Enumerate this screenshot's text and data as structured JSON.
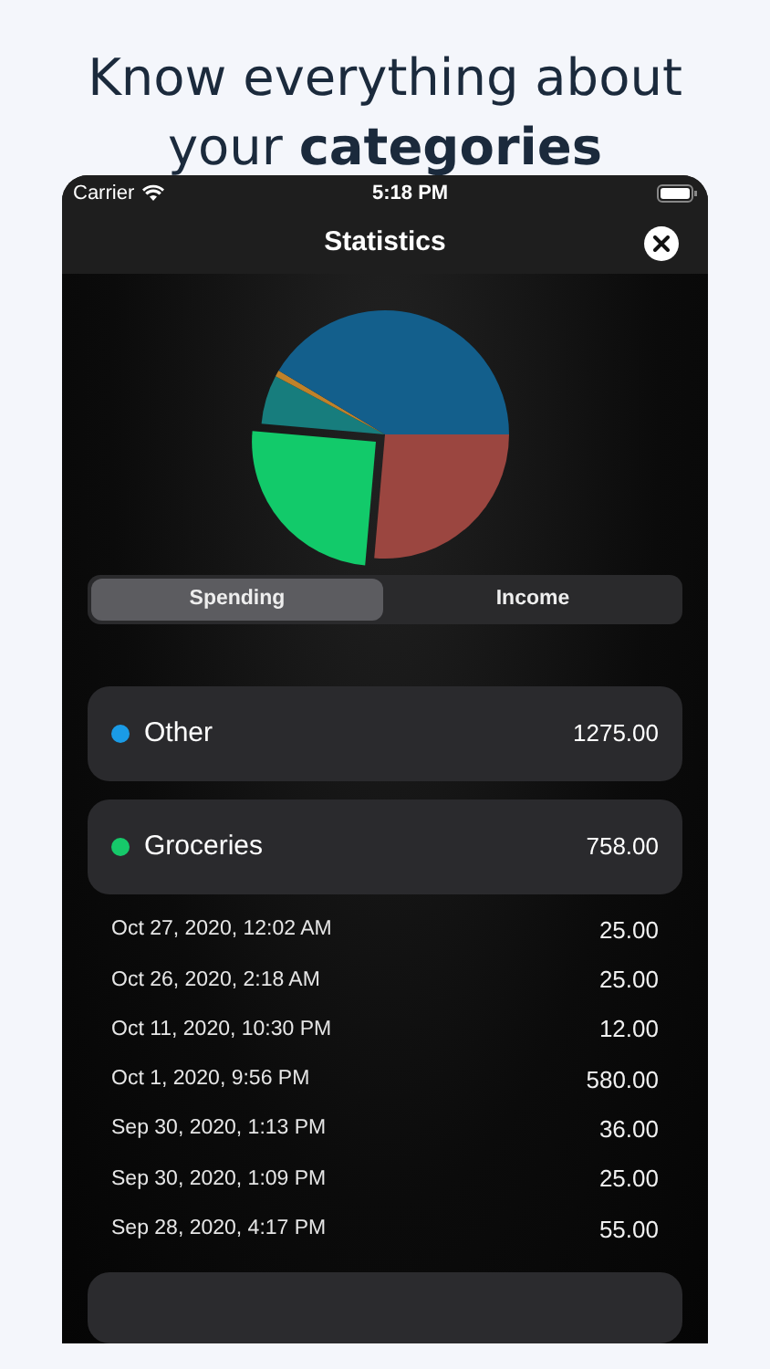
{
  "headline": {
    "line_1": "Know everything about",
    "line_2": "your **categories**"
  },
  "status_bar": {
    "carrier": "Carrier",
    "time": "5:18 PM"
  },
  "nav": {
    "title": "Statistics"
  },
  "segments": [
    {
      "label": "Spending",
      "selected": true
    },
    {
      "label": "Income",
      "selected": false
    }
  ],
  "categories": [
    {
      "name": "Other",
      "color": "#1a9be6",
      "amount": "1275.00"
    },
    {
      "name": "Groceries",
      "color": "#16c96a",
      "amount": "758.00"
    }
  ],
  "transactions": [
    {
      "date": "Oct 27, 2020, 12:02 AM",
      "amount": "25.00"
    },
    {
      "date": "Oct 26, 2020, 2:18 AM",
      "amount": "25.00"
    },
    {
      "date": "Oct 11, 2020, 10:30 PM",
      "amount": "12.00"
    },
    {
      "date": "Oct 1, 2020, 9:56 PM",
      "amount": "580.00"
    },
    {
      "date": "Sep 30, 2020, 1:13 PM",
      "amount": "36.00"
    },
    {
      "date": "Sep 30, 2020, 1:09 PM",
      "amount": "25.00"
    },
    {
      "date": "Sep 28, 2020, 4:17 PM",
      "amount": "55.00"
    }
  ]
}
